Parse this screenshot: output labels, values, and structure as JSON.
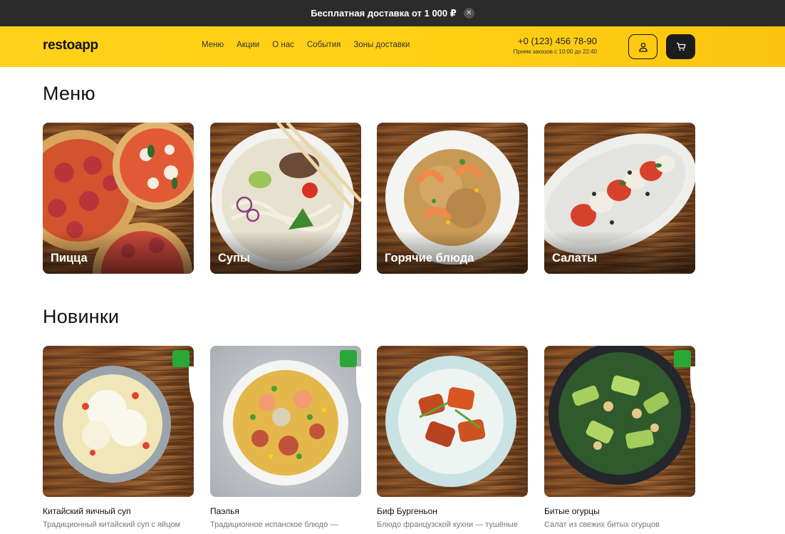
{
  "promo": {
    "text": "Бесплатная доставка от 1 000 ₽",
    "close_icon": "close-icon"
  },
  "header": {
    "logo": "restoapp",
    "nav": [
      "Меню",
      "Акции",
      "О нас",
      "События",
      "Зоны доставки"
    ],
    "phone": "+0 (123) 456 78-90",
    "hours": "Прием заказов с 10:00 до 22:40",
    "user_icon": "user-icon",
    "cart_icon": "cart-icon",
    "accent": "#ffd21a"
  },
  "menu": {
    "title": "Меню",
    "categories": [
      {
        "label": "Пицца"
      },
      {
        "label": "Супы"
      },
      {
        "label": "Горячие блюда"
      },
      {
        "label": "Салаты"
      }
    ]
  },
  "news": {
    "title": "Новинки",
    "badge_icon": "leaf-icon",
    "badge_color": "#2aa836",
    "items": [
      {
        "name": "Китайский яичный суп",
        "desc": "Традиционный китайский суп с яйцом"
      },
      {
        "name": "Паэлья",
        "desc": "Традиционное испанское блюдо —"
      },
      {
        "name": "Биф Бургеньон",
        "desc": "Блюдо французской кухни — тушёные"
      },
      {
        "name": "Битые огурцы",
        "desc": "Салат из свежих битых огурцов"
      }
    ]
  }
}
